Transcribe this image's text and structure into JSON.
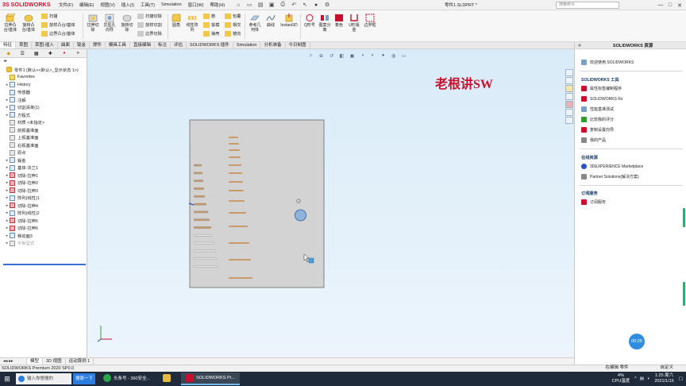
{
  "app": {
    "logo_ds": "3S",
    "logo_sw": "SOLIDWORKS",
    "menu": [
      "文件(F)",
      "编辑(E)",
      "视图(V)",
      "插入(I)",
      "工具(T)",
      "Simulation",
      "窗口(W)",
      "帮助(H)"
    ],
    "doc_title": "零件1.SLDPRT *",
    "search_placeholder": "搜索命令",
    "win_min": "—",
    "win_max": "□",
    "win_close": "✕"
  },
  "ribbon": {
    "big": [
      {
        "label": "拉伸凸\n台/基体"
      },
      {
        "label": "旋转凸\n台/基体"
      },
      {
        "label": "拉伸切\n除"
      },
      {
        "label": "异型孔\n向导"
      },
      {
        "label": "旋转切\n除"
      },
      {
        "label": "圆角"
      },
      {
        "label": "线性阵\n列"
      },
      {
        "label": "参考几\n何体"
      },
      {
        "label": "曲线"
      },
      {
        "label": "Instant3D"
      },
      {
        "label": "Q形号"
      },
      {
        "label": "图案分\n离"
      },
      {
        "label": "着色"
      },
      {
        "label": "U形钣\n金"
      },
      {
        "label": "边界框"
      }
    ],
    "small": [
      "扫描",
      "放样凸台/基体",
      "边界凸台/基体",
      "扫描切除",
      "放样切割",
      "边界切除",
      "筋",
      "拔模",
      "抽壳",
      "包覆",
      "相交",
      "镜向"
    ]
  },
  "tabs": [
    "特征",
    "草图",
    "草图-插入",
    "曲面",
    "钣金",
    "焊件",
    "模具工具",
    "直接编辑",
    "标注",
    "评估",
    "SOLIDWORKS 插件",
    "Simulation",
    "分析准备",
    "今日制图"
  ],
  "tree": [
    {
      "label": "零件1 (默认<<默认>_显示状态 1>)",
      "icon": "part",
      "arrow": "",
      "indent": 0
    },
    {
      "label": "Favorites",
      "icon": "yellow",
      "arrow": "",
      "indent": 1
    },
    {
      "label": "History",
      "icon": "blue",
      "arrow": "▸",
      "indent": 1
    },
    {
      "label": "传感器",
      "icon": "blue",
      "arrow": "",
      "indent": 1
    },
    {
      "label": "注解",
      "icon": "blue",
      "arrow": "▸",
      "indent": 1
    },
    {
      "label": "切割清单(1)",
      "icon": "blue",
      "arrow": "▸",
      "indent": 1
    },
    {
      "label": "方程式",
      "icon": "blue",
      "arrow": "▸",
      "indent": 1
    },
    {
      "label": "材质 <未指定>",
      "icon": "gray",
      "arrow": "",
      "indent": 1
    },
    {
      "label": "前视基准面",
      "icon": "gray",
      "arrow": "",
      "indent": 1
    },
    {
      "label": "上视基准面",
      "icon": "gray",
      "arrow": "",
      "indent": 1
    },
    {
      "label": "右视基准面",
      "icon": "gray",
      "arrow": "",
      "indent": 1
    },
    {
      "label": "原点",
      "icon": "gray",
      "arrow": "",
      "indent": 1
    },
    {
      "label": "钣金",
      "icon": "blue",
      "arrow": "▸",
      "indent": 1
    },
    {
      "label": "基体-法兰1",
      "icon": "blue",
      "arrow": "▸",
      "indent": 1
    },
    {
      "label": "切除-拉伸1",
      "icon": "red",
      "arrow": "▸",
      "indent": 1
    },
    {
      "label": "切除-拉伸2",
      "icon": "red",
      "arrow": "▸",
      "indent": 1
    },
    {
      "label": "切除-拉伸3",
      "icon": "red",
      "arrow": "▸",
      "indent": 1
    },
    {
      "label": "阵列(线性)1",
      "icon": "blue",
      "arrow": "▸",
      "indent": 1
    },
    {
      "label": "切除-拉伸4",
      "icon": "red",
      "arrow": "▸",
      "indent": 1
    },
    {
      "label": "阵列(线性)2",
      "icon": "blue",
      "arrow": "▸",
      "indent": 1
    },
    {
      "label": "切除-拉伸5",
      "icon": "red",
      "arrow": "▸",
      "indent": 1
    },
    {
      "label": "切除-拉伸6",
      "icon": "red",
      "arrow": "▸",
      "indent": 1
    },
    {
      "label": "移动面3",
      "icon": "blue",
      "arrow": "▸",
      "indent": 1
    },
    {
      "label": "平板型式",
      "icon": "gray",
      "arrow": "▸",
      "indent": 1,
      "faded": true
    }
  ],
  "bottom_tabs": [
    "模型",
    "3D 视图",
    "运动算例 1"
  ],
  "status": {
    "left": "SOLIDWORKS Premium 2020 SP0.0",
    "editing": "在编辑 零件",
    "custom": "自定义"
  },
  "watermark": "老根讲SW",
  "taskpane": {
    "title": "SOLIDWORKS 资源",
    "welcome": "欢迎使用 SOLIDWORKS",
    "tools_title": "SOLIDWORKS 工具",
    "tools": [
      "属性标签编制程序",
      "SOLIDWORKS Rx",
      "性能基准测试",
      "比较我的评分",
      "复制设置向导",
      "我的产品"
    ],
    "community_title": "在线资源",
    "community": [
      "3DEXPERIENCE Marketplace",
      "Partner Solutions(解决方案)"
    ],
    "subscription_title": "订阅服务",
    "subscription": [
      "订阅服务"
    ]
  },
  "timer": "00:25",
  "taskbar": {
    "search_placeholder": "输入你想搜的",
    "search_button": "搜索一下",
    "apps": [
      "头条号 - 360安全...",
      "SOLIDWORKS Pr..."
    ],
    "cpu": "4%",
    "cpu_label": "CPU温度",
    "time": "1:25 周六",
    "date": "2021/1/16"
  },
  "colors": {
    "accent": "#c8102e",
    "viewport_top": "#d9ebf8",
    "plate": "#d3d3d3",
    "slot": "#c89b6b"
  }
}
